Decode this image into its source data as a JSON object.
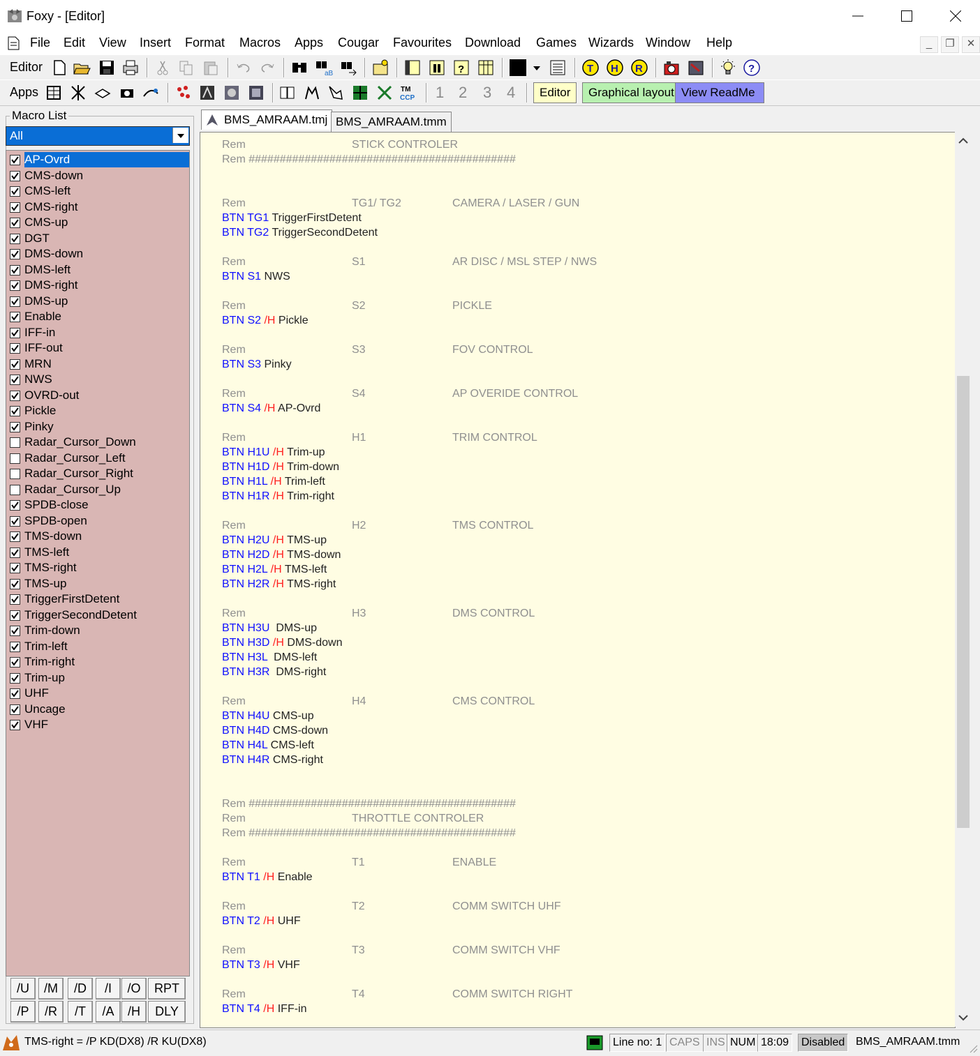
{
  "window": {
    "title": "Foxy - [Editor]"
  },
  "menu": [
    "File",
    "Edit",
    "View",
    "Insert",
    "Format",
    "Macros",
    "Apps",
    "Cougar",
    "Favourites",
    "Download",
    "Games",
    "Wizards",
    "Window",
    "Help"
  ],
  "mdi_controls": {
    "minimize": "_",
    "restore": "❐",
    "close": "✕"
  },
  "toolbar1": {
    "label": "Editor"
  },
  "toolbar2": {
    "label": "Apps",
    "numbers": [
      "1",
      "2",
      "3",
      "4"
    ],
    "editor_btn": "Editor",
    "graphical_btn": "Graphical layout",
    "readme_btn": "View ReadMe"
  },
  "colors": {
    "editor_chip": "#ffffc8",
    "graphical_chip": "#b8f0b0",
    "readme_chip": "#8c8cf5",
    "list_bg": "#d9b6b4",
    "editor_bg": "#fffde3"
  },
  "macro_panel": {
    "legend": "Macro List",
    "filter": "All",
    "items": [
      {
        "label": "AP-Ovrd",
        "checked": true,
        "selected": true
      },
      {
        "label": "CMS-down",
        "checked": true
      },
      {
        "label": "CMS-left",
        "checked": true
      },
      {
        "label": "CMS-right",
        "checked": true
      },
      {
        "label": "CMS-up",
        "checked": true
      },
      {
        "label": "DGT",
        "checked": true
      },
      {
        "label": "DMS-down",
        "checked": true
      },
      {
        "label": "DMS-left",
        "checked": true
      },
      {
        "label": "DMS-right",
        "checked": true
      },
      {
        "label": "DMS-up",
        "checked": true
      },
      {
        "label": "Enable",
        "checked": true
      },
      {
        "label": "IFF-in",
        "checked": true
      },
      {
        "label": "IFF-out",
        "checked": true
      },
      {
        "label": "MRN",
        "checked": true
      },
      {
        "label": "NWS",
        "checked": true
      },
      {
        "label": "OVRD-out",
        "checked": true
      },
      {
        "label": "Pickle",
        "checked": true
      },
      {
        "label": "Pinky",
        "checked": true
      },
      {
        "label": "Radar_Cursor_Down",
        "checked": false
      },
      {
        "label": "Radar_Cursor_Left",
        "checked": false
      },
      {
        "label": "Radar_Cursor_Right",
        "checked": false
      },
      {
        "label": "Radar_Cursor_Up",
        "checked": false
      },
      {
        "label": "SPDB-close",
        "checked": true
      },
      {
        "label": "SPDB-open",
        "checked": true
      },
      {
        "label": "TMS-down",
        "checked": true
      },
      {
        "label": "TMS-left",
        "checked": true
      },
      {
        "label": "TMS-right",
        "checked": true
      },
      {
        "label": "TMS-up",
        "checked": true
      },
      {
        "label": "TriggerFirstDetent",
        "checked": true
      },
      {
        "label": "TriggerSecondDetent",
        "checked": true
      },
      {
        "label": "Trim-down",
        "checked": true
      },
      {
        "label": "Trim-left",
        "checked": true
      },
      {
        "label": "Trim-right",
        "checked": true
      },
      {
        "label": "Trim-up",
        "checked": true
      },
      {
        "label": "UHF",
        "checked": true
      },
      {
        "label": "Uncage",
        "checked": true
      },
      {
        "label": "VHF",
        "checked": true
      }
    ],
    "buttons_row1": [
      "/U",
      "/M",
      "/D",
      "/I",
      "/O",
      "RPT"
    ],
    "buttons_row2": [
      "/P",
      "/R",
      "/T",
      "/A",
      "/H",
      "DLY"
    ]
  },
  "tabs": [
    {
      "label": "BMS_AMRAAM.tmj",
      "active": true
    },
    {
      "label": "BMS_AMRAAM.tmm",
      "active": false
    }
  ],
  "editor_lines": [
    {
      "row": 0,
      "type": "rem",
      "c1": "Rem",
      "c2": "STICK CONTROLER",
      "c3": ""
    },
    {
      "row": 1,
      "type": "text",
      "text": "Rem ###########################################"
    },
    {
      "row": 4,
      "type": "rem",
      "c1": "Rem",
      "c2": "TG1/ TG2",
      "c3": "CAMERA / LASER / GUN"
    },
    {
      "row": 5,
      "type": "btn",
      "kw": "BTN TG1",
      "h": "",
      "act": "TriggerFirstDetent"
    },
    {
      "row": 6,
      "type": "btn",
      "kw": "BTN TG2",
      "h": "",
      "act": "TriggerSecondDetent"
    },
    {
      "row": 8,
      "type": "rem",
      "c1": "Rem",
      "c2": "S1",
      "c3": "AR DISC / MSL STEP / NWS"
    },
    {
      "row": 9,
      "type": "btn",
      "kw": "BTN S1",
      "h": "",
      "act": "NWS"
    },
    {
      "row": 11,
      "type": "rem",
      "c1": "Rem",
      "c2": "S2",
      "c3": "PICKLE"
    },
    {
      "row": 12,
      "type": "btn",
      "kw": "BTN S2",
      "h": "/H",
      "act": "Pickle"
    },
    {
      "row": 14,
      "type": "rem",
      "c1": "Rem",
      "c2": "S3",
      "c3": "FOV CONTROL"
    },
    {
      "row": 15,
      "type": "btn",
      "kw": "BTN S3",
      "h": "",
      "act": "Pinky"
    },
    {
      "row": 17,
      "type": "rem",
      "c1": "Rem",
      "c2": "S4",
      "c3": "AP OVERIDE CONTROL"
    },
    {
      "row": 18,
      "type": "btn",
      "kw": "BTN S4",
      "h": "/H",
      "act": "AP-Ovrd"
    },
    {
      "row": 20,
      "type": "rem",
      "c1": "Rem",
      "c2": "H1",
      "c3": "TRIM CONTROL"
    },
    {
      "row": 21,
      "type": "btn",
      "kw": "BTN H1U",
      "h": "/H",
      "act": "Trim-up"
    },
    {
      "row": 22,
      "type": "btn",
      "kw": "BTN H1D",
      "h": "/H",
      "act": "Trim-down"
    },
    {
      "row": 23,
      "type": "btn",
      "kw": "BTN H1L",
      "h": "/H",
      "act": "Trim-left"
    },
    {
      "row": 24,
      "type": "btn",
      "kw": "BTN H1R",
      "h": "/H",
      "act": "Trim-right"
    },
    {
      "row": 26,
      "type": "rem",
      "c1": "Rem",
      "c2": "H2",
      "c3": "TMS CONTROL"
    },
    {
      "row": 27,
      "type": "btn",
      "kw": "BTN H2U",
      "h": "/H",
      "act": "TMS-up"
    },
    {
      "row": 28,
      "type": "btn",
      "kw": "BTN H2D",
      "h": "/H",
      "act": "TMS-down"
    },
    {
      "row": 29,
      "type": "btn",
      "kw": "BTN H2L",
      "h": "/H",
      "act": "TMS-left"
    },
    {
      "row": 30,
      "type": "btn",
      "kw": "BTN H2R",
      "h": "/H",
      "act": "TMS-right"
    },
    {
      "row": 32,
      "type": "rem",
      "c1": "Rem",
      "c2": "H3",
      "c3": "DMS CONTROL"
    },
    {
      "row": 33,
      "type": "btn",
      "kw": "BTN H3U",
      "h": "",
      "act": " DMS-up"
    },
    {
      "row": 34,
      "type": "btn",
      "kw": "BTN H3D",
      "h": "/H",
      "act": "DMS-down"
    },
    {
      "row": 35,
      "type": "btn",
      "kw": "BTN H3L",
      "h": "",
      "act": " DMS-left"
    },
    {
      "row": 36,
      "type": "btn",
      "kw": "BTN H3R",
      "h": "",
      "act": " DMS-right"
    },
    {
      "row": 38,
      "type": "rem",
      "c1": "Rem",
      "c2": "H4",
      "c3": "CMS CONTROL"
    },
    {
      "row": 39,
      "type": "btn",
      "kw": "BTN H4U",
      "h": "",
      "act": "CMS-up"
    },
    {
      "row": 40,
      "type": "btn",
      "kw": "BTN H4D",
      "h": "",
      "act": "CMS-down"
    },
    {
      "row": 41,
      "type": "btn",
      "kw": "BTN H4L",
      "h": "",
      "act": "CMS-left"
    },
    {
      "row": 42,
      "type": "btn",
      "kw": "BTN H4R",
      "h": "",
      "act": "CMS-right"
    },
    {
      "row": 45,
      "type": "text",
      "text": "Rem ###########################################"
    },
    {
      "row": 46,
      "type": "rem",
      "c1": "Rem",
      "c2": "THROTTLE CONTROLER",
      "c3": ""
    },
    {
      "row": 47,
      "type": "text",
      "text": "Rem ###########################################"
    },
    {
      "row": 49,
      "type": "rem",
      "c1": "Rem",
      "c2": "T1",
      "c3": "ENABLE"
    },
    {
      "row": 50,
      "type": "btn",
      "kw": "BTN T1",
      "h": "/H",
      "act": "Enable"
    },
    {
      "row": 52,
      "type": "rem",
      "c1": "Rem",
      "c2": "T2",
      "c3": "COMM SWITCH UHF"
    },
    {
      "row": 53,
      "type": "btn",
      "kw": "BTN T2",
      "h": "/H",
      "act": "UHF"
    },
    {
      "row": 55,
      "type": "rem",
      "c1": "Rem",
      "c2": "T3",
      "c3": "COMM SWITCH VHF"
    },
    {
      "row": 56,
      "type": "btn",
      "kw": "BTN T3",
      "h": "/H",
      "act": "VHF"
    },
    {
      "row": 58,
      "type": "rem",
      "c1": "Rem",
      "c2": "T4",
      "c3": "COMM SWITCH RIGHT"
    },
    {
      "row": 59,
      "type": "btn",
      "kw": "BTN T4",
      "h": "/H",
      "act": "IFF-in"
    }
  ],
  "status": {
    "macro_def": "TMS-right = /P KD(DX8) /R KU(DX8)",
    "line_no": "Line no: 1",
    "caps": "CAPS",
    "ins": "INS",
    "num": "NUM",
    "time": "18:09",
    "state": "Disabled",
    "file": "BMS_AMRAAM.tmm"
  },
  "icons": {
    "toolbar1": [
      "new-file-icon",
      "open-folder-icon",
      "save-icon",
      "print-icon",
      "cut-icon",
      "copy-icon",
      "paste-icon",
      "undo-icon",
      "redo-icon",
      "find-icon",
      "replace-icon",
      "find-next-icon",
      "insert-image-icon",
      "panel-icon",
      "column-icon",
      "help-page-icon",
      "table-icon",
      "color-picker-icon",
      "list-icon",
      "t-circle-icon",
      "h-circle-icon",
      "r-circle-icon",
      "camera-red-icon",
      "device-icon",
      "lightbulb-icon",
      "help-icon"
    ],
    "toolbar2": [
      "app1-icon",
      "app2-icon",
      "app3-icon",
      "app4-icon",
      "app5-icon",
      "app6-icon",
      "app7-icon",
      "app8-icon",
      "app9-icon",
      "app10-icon",
      "app11-icon",
      "app12-icon",
      "app13-icon",
      "app14-icon",
      "tmccp-icon"
    ]
  }
}
